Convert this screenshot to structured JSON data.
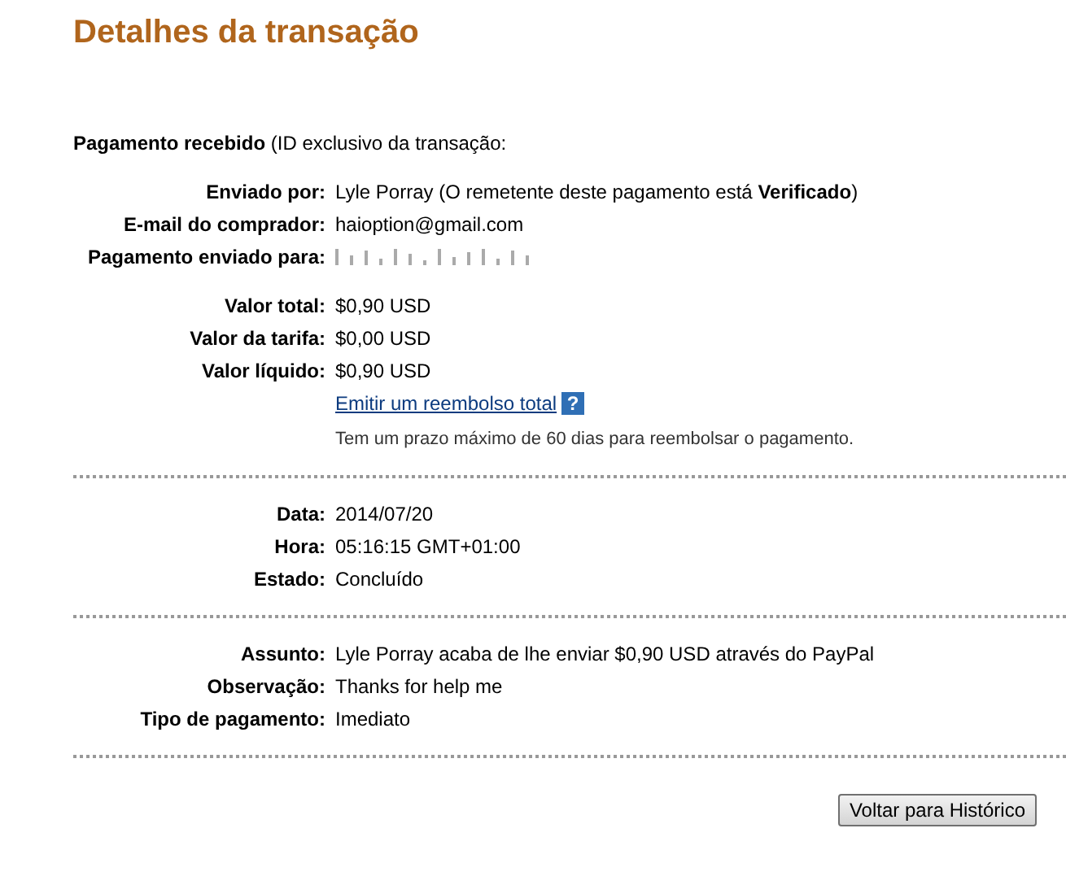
{
  "title": "Detalhes da transação",
  "intro": "**Pagamento recebido** (ID exclusivo da transação:",
  "sections": [
    {
      "groups": [
        {
          "rows": [
            {
              "kind": "text",
              "label": "Enviado por:",
              "value": "Lyle Porray (O remetente deste pagamento está **Verificado**)"
            },
            {
              "kind": "text",
              "label": "E-mail do comprador:",
              "value": "haioption@gmail.com"
            },
            {
              "kind": "redacted",
              "label": "Pagamento enviado para:"
            }
          ]
        },
        {
          "rows": [
            {
              "kind": "text",
              "label": "Valor total:",
              "value": "$0,90 USD"
            },
            {
              "kind": "text",
              "label": "Valor da tarifa:",
              "value": "$0,00 USD"
            },
            {
              "kind": "text",
              "label": "Valor líquido:",
              "value": "$0,90 USD"
            },
            {
              "kind": "link",
              "value": "Emitir um reembolso total",
              "help": "?"
            },
            {
              "kind": "note",
              "value": "Tem um prazo máximo de 60 dias para reembolsar o pagamento."
            }
          ]
        }
      ]
    },
    {
      "groups": [
        {
          "rows": [
            {
              "kind": "text",
              "label": "Data:",
              "value": "2014/07/20"
            },
            {
              "kind": "text",
              "label": "Hora:",
              "value": "05:16:15 GMT+01:00"
            },
            {
              "kind": "text",
              "label": "Estado:",
              "value": "Concluído"
            }
          ]
        }
      ]
    },
    {
      "groups": [
        {
          "rows": [
            {
              "kind": "text",
              "label": "Assunto:",
              "value": "Lyle Porray acaba de lhe enviar $0,90 USD através do PayPal"
            },
            {
              "kind": "text",
              "label": "Observação:",
              "value": "Thanks for help me"
            },
            {
              "kind": "text",
              "label": "Tipo de pagamento:",
              "value": "Imediato"
            }
          ]
        }
      ]
    }
  ],
  "button": "Voltar para Histórico"
}
